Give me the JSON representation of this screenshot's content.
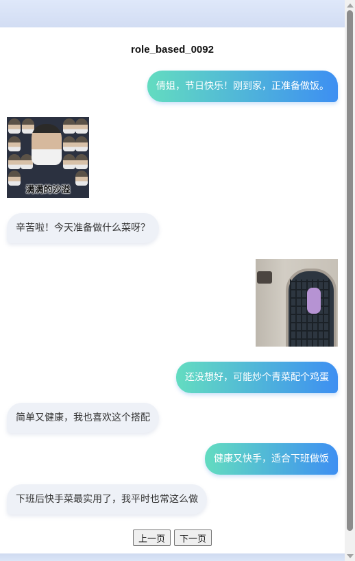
{
  "page": {
    "title": "role_based_0092"
  },
  "messages": [
    {
      "role": "user",
      "text": "倩姐，节日快乐！刚到家，正准备做饭。"
    },
    {
      "role": "bot",
      "type": "image",
      "caption": "满满的沙溢"
    },
    {
      "role": "bot",
      "text": "辛苦啦！今天准备做什么菜呀？"
    },
    {
      "role": "user",
      "type": "image"
    },
    {
      "role": "user",
      "text": "还没想好，可能炒个青菜配个鸡蛋"
    },
    {
      "role": "bot",
      "text": "简单又健康，我也喜欢这个搭配"
    },
    {
      "role": "user",
      "text": "健康又快手，适合下班做饭"
    },
    {
      "role": "bot",
      "text": "下班后快手菜最实用了，我平时也常这么做"
    }
  ],
  "pager": {
    "prev_label": "上一页",
    "next_label": "下一页"
  },
  "colors": {
    "user_bubble_start": "#63dcc0",
    "user_bubble_end": "#3d8ff2",
    "bot_bubble": "#eef1f7",
    "background": "#dde7f8"
  }
}
